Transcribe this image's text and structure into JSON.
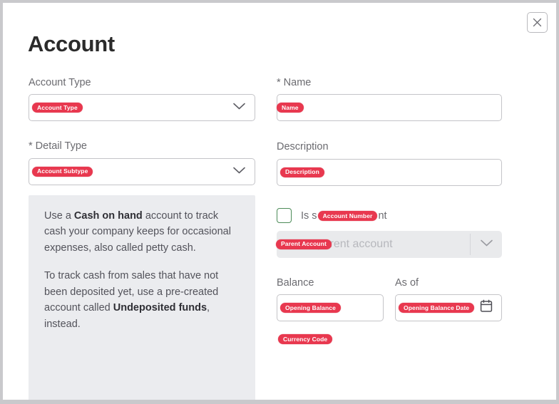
{
  "dialog": {
    "title": "Account",
    "close_label": "×",
    "close_icon": "close-icon"
  },
  "left_column": {
    "account_type": {
      "label": "Account Type",
      "badge": "Account Type",
      "value": "",
      "chevron_icon": "chevron-down-icon"
    },
    "detail_type": {
      "label": "* Detail Type",
      "badge": "Account Subtype",
      "value": "",
      "chevron_icon": "chevron-down-icon"
    },
    "info_box": {
      "paragraph1_pre": "Use a ",
      "paragraph1_bold": "Cash on hand",
      "paragraph1_post": " account to track cash your company keeps for occasional expenses, also called petty cash.",
      "paragraph2_pre": "To track cash from sales that have not been deposited yet, use a pre-created account called ",
      "paragraph2_bold": "Undeposited funds",
      "paragraph2_post": ", instead."
    }
  },
  "right_column": {
    "name": {
      "label": "* Name",
      "badge": "Name",
      "value": ""
    },
    "description": {
      "label": "Description",
      "badge": "Description",
      "value": ""
    },
    "sub_account": {
      "label_pre": "Is s",
      "badge": "Account Number",
      "label_post": "nt",
      "checked": false
    },
    "parent_account": {
      "badge": "Parent Account",
      "placeholder": "Enter parent account",
      "disabled": true,
      "chevron_icon": "chevron-down-icon"
    },
    "balance": {
      "label": "Balance",
      "badge": "Opening Balance",
      "value": ""
    },
    "as_of": {
      "label": "As of",
      "badge": "Opening Balance Date",
      "value": "",
      "calendar_icon": "calendar-icon"
    },
    "currency_code": {
      "badge": "Currency Code"
    }
  },
  "colors": {
    "badge_red": "#e8384f",
    "info_bg": "#ebecef",
    "checkbox_green": "#4c8b58",
    "border_gray": "#c4c4c8",
    "label_gray": "#6b6b70"
  }
}
